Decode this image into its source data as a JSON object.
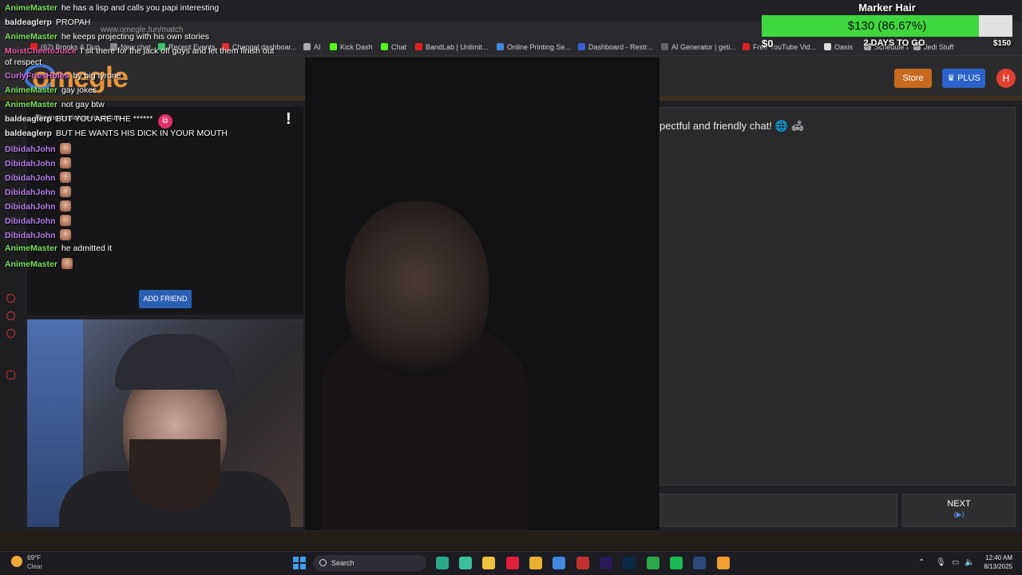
{
  "browser": {
    "url": "www.omegle.fun/match",
    "bookmarks": [
      {
        "label": "(62) Brooks & Dun...",
        "icon": "youtube-icon",
        "color": "#e02020"
      },
      {
        "label": "New chat",
        "icon": "chatgpt-icon",
        "color": "#888888"
      },
      {
        "label": "Recent Events",
        "icon": "events-icon",
        "color": "#3fbf6a"
      },
      {
        "label": "Changel dashboar...",
        "icon": "dashboard-icon",
        "color": "#e03030"
      },
      {
        "label": "AI",
        "icon": "folder-icon",
        "color": "#aaaaaa"
      },
      {
        "label": "Kick Dash",
        "icon": "kick-icon",
        "color": "#53fc18"
      },
      {
        "label": "Chat",
        "icon": "kick-icon",
        "color": "#53fc18"
      },
      {
        "label": "BandLab | Unlimit...",
        "icon": "bandlab-icon",
        "color": "#e02020"
      },
      {
        "label": "Online Printing Se...",
        "icon": "printing-icon",
        "color": "#3f8ae0"
      },
      {
        "label": "Dashboard - Restr...",
        "icon": "restream-icon",
        "color": "#3a5fd8"
      },
      {
        "label": "AI Generator | geti...",
        "icon": "ai-generator-icon",
        "color": "#666666"
      },
      {
        "label": "Free YouTube Vid...",
        "icon": "download-icon",
        "color": "#e02020"
      },
      {
        "label": "Oasis",
        "icon": "oasis-icon",
        "color": "#dddddd"
      },
      {
        "label": "Schedule I",
        "icon": "folder-icon",
        "color": "#aaaaaa"
      },
      {
        "label": "Jedi Stuff",
        "icon": "folder-icon",
        "color": "#aaaaaa"
      }
    ]
  },
  "site": {
    "logo": "omegle",
    "store_label": "Store",
    "plus_label": "PLUS",
    "avatar_letter": "H",
    "pip_label": "Playing in picture-in-picture",
    "add_friend_label": "ADD FRIEND",
    "welcome_text": "pectful and friendly chat! 🌐 🛋",
    "next_label": "NEXT",
    "next_sub": "(▶)"
  },
  "goal": {
    "title": "Marker Hair",
    "amount_text": "$130 (86.67%)",
    "progress": 0.8667,
    "min_label": "$0",
    "days_label": "2 DAYS TO GO",
    "max_label": "$150",
    "fill_color": "#3fd63f"
  },
  "chat": [
    {
      "nick": "AnimeMaster",
      "cls": "n-anime",
      "msg": "he has a lisp and calls you papi interesting"
    },
    {
      "nick": "baldeaglerp",
      "cls": "n-bald",
      "msg": "PROPAH"
    },
    {
      "nick": "AnimeMaster",
      "cls": "n-anime",
      "msg": "he keeps projecting with his own stories"
    },
    {
      "nick": "MoistCheetoJuice",
      "cls": "n-moist",
      "msg": "I sit there for the jack off guys and let them finish out"
    },
    {
      "nick": "",
      "cls": "n-bald",
      "msg": "of respect"
    },
    {
      "nick": "CurlyFriesHoles",
      "cls": "n-curly",
      "msg": "by big tyrone"
    },
    {
      "nick": "AnimeMaster",
      "cls": "n-anime",
      "msg": "gay jokes"
    },
    {
      "nick": "AnimeMaster",
      "cls": "n-anime",
      "msg": "not gay btw"
    },
    {
      "nick": "baldeaglerp",
      "cls": "n-bald",
      "msg": "BUT YOU ARE THE ******"
    },
    {
      "nick": "baldeaglerp",
      "cls": "n-bald",
      "msg": "BUT HE WANTS HIS DICK IN YOUR MOUTH"
    },
    {
      "nick": "DibidahJohn",
      "cls": "n-dibi",
      "msg": "",
      "emote": true
    },
    {
      "nick": "DibidahJohn",
      "cls": "n-dibi",
      "msg": "",
      "emote": true
    },
    {
      "nick": "DibidahJohn",
      "cls": "n-dibi",
      "msg": "",
      "emote": true
    },
    {
      "nick": "DibidahJohn",
      "cls": "n-dibi",
      "msg": "",
      "emote": true
    },
    {
      "nick": "DibidahJohn",
      "cls": "n-dibi",
      "msg": "",
      "emote": true
    },
    {
      "nick": "DibidahJohn",
      "cls": "n-dibi",
      "msg": "",
      "emote": true
    },
    {
      "nick": "DibidahJohn",
      "cls": "n-dibi",
      "msg": "",
      "emote": true
    },
    {
      "nick": "AnimeMaster",
      "cls": "n-anime",
      "msg": "he admitted it"
    },
    {
      "nick": "AnimeMaster",
      "cls": "n-anime",
      "msg": "",
      "emote": true
    }
  ],
  "taskbar": {
    "weather_temp": "69°F",
    "weather_cond": "Clear",
    "search_label": "Search",
    "time": "12:40 AM",
    "date": "8/13/2025",
    "apps": [
      {
        "name": "audition-icon",
        "color": "#2aa88a"
      },
      {
        "name": "app-icon",
        "color": "#3bbf9a"
      },
      {
        "name": "file-explorer-icon",
        "color": "#f0c040"
      },
      {
        "name": "opera-icon",
        "color": "#e0203a"
      },
      {
        "name": "chrome-icon",
        "color": "#e8b030"
      },
      {
        "name": "photos-icon",
        "color": "#3f8ae0"
      },
      {
        "name": "news-icon",
        "color": "#c03030"
      },
      {
        "name": "premiere-icon",
        "color": "#2a1a5a"
      },
      {
        "name": "photoshop-icon",
        "color": "#0a2a4a"
      },
      {
        "name": "xbox-icon",
        "color": "#2aa84a"
      },
      {
        "name": "spotify-icon",
        "color": "#1db954"
      },
      {
        "name": "steam-icon",
        "color": "#2a4a7a"
      },
      {
        "name": "discord-icon",
        "color": "#f0a030"
      }
    ]
  }
}
